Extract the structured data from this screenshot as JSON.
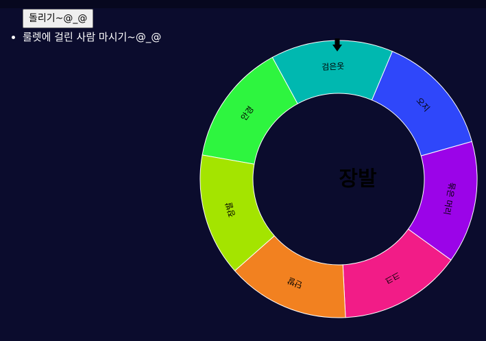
{
  "controls": {
    "spin_label": "돌리기~@_@"
  },
  "rules": [
    "룰렛에 걸린 사람 마시기~@_@"
  ],
  "roulette": {
    "result": "장발",
    "segments": [
      {
        "label": "안경",
        "color": "#2ef53f"
      },
      {
        "label": "검은옷",
        "color": "#00b8b0"
      },
      {
        "label": "오지",
        "color": "#2f47fa"
      },
      {
        "label": "묶은 머리",
        "color": "#9b04e8"
      },
      {
        "label": "크크",
        "color": "#f21c87"
      },
      {
        "label": "단발",
        "color": "#f28120"
      },
      {
        "label": "장발",
        "color": "#a4e400"
      }
    ]
  }
}
